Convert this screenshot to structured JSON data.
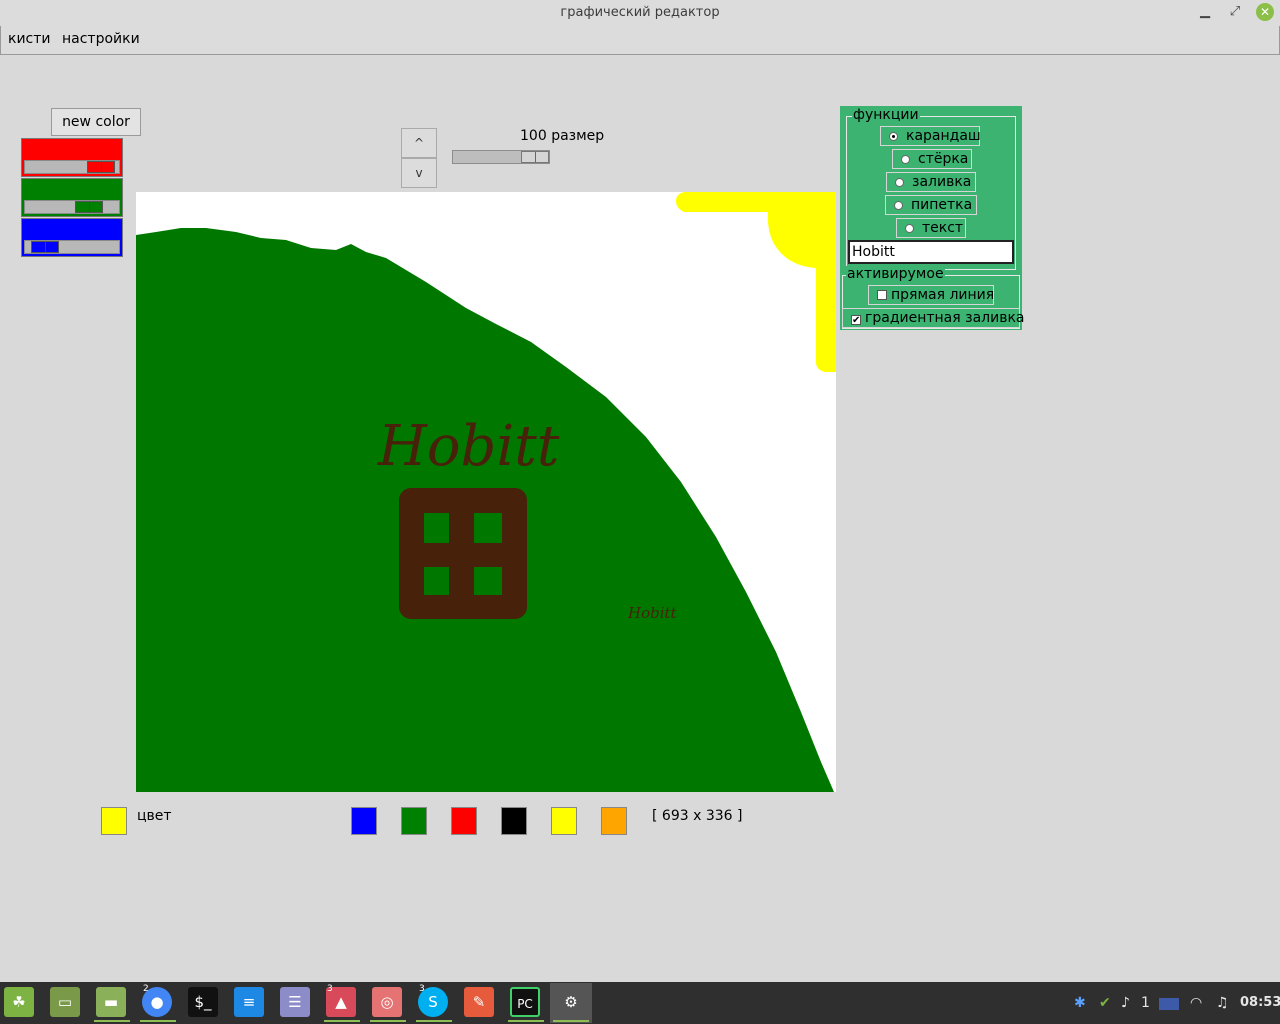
{
  "window": {
    "title": "графический редактор",
    "minimize": "▁",
    "maximize": "⤢",
    "close": "✕"
  },
  "menu": {
    "items": [
      "кисти",
      "настройки"
    ]
  },
  "color_panel": {
    "new_color_label": "new color",
    "sliders": [
      {
        "name": "red",
        "color": "#ff0000",
        "value_percent": 92
      },
      {
        "name": "green",
        "color": "#008000",
        "value_percent": 75
      },
      {
        "name": "blue",
        "color": "#0000ff",
        "value_percent": 10
      }
    ]
  },
  "size": {
    "up_label": "^",
    "down_label": "v",
    "value": "100",
    "label": "размер"
  },
  "canvas": {
    "big_text": "Hobitt",
    "small_text": "Hobitt",
    "colors": {
      "hill": "#007800",
      "door": "#47210a",
      "sun": "#ffff00",
      "window": "#007800"
    }
  },
  "functions": {
    "group_title": "функции",
    "tools": [
      {
        "label": "карандаш",
        "selected": true
      },
      {
        "label": "стёрка",
        "selected": false
      },
      {
        "label": "заливка",
        "selected": false
      },
      {
        "label": "пипетка",
        "selected": false
      },
      {
        "label": "текст",
        "selected": false
      }
    ],
    "text_value": "Hobitt",
    "active_title": "активирумое",
    "options": [
      {
        "label": "прямая линия",
        "checked": false
      },
      {
        "label": "градиентная заливка",
        "checked": true
      }
    ],
    "accent": "#3cb371"
  },
  "bottom": {
    "current_color": "#ffff00",
    "color_label": "цвет",
    "palette": [
      "#0000ff",
      "#008000",
      "#ff0000",
      "#000000",
      "#ffff00",
      "#ffa500"
    ],
    "coords": "[ 693 x 336 ]"
  },
  "taskbar": {
    "badges": {
      "chrome": "2",
      "photos": "3",
      "skype": "3"
    },
    "tray_count": "1",
    "clock": "08:53"
  }
}
